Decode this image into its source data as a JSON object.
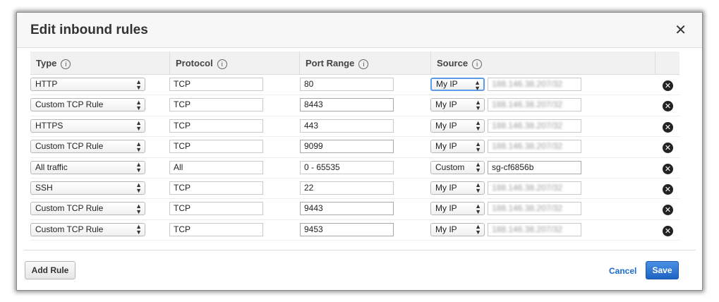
{
  "modal": {
    "title": "Edit inbound rules",
    "close_glyph": "✕"
  },
  "columns": {
    "type": "Type",
    "protocol": "Protocol",
    "port_range": "Port Range",
    "source": "Source",
    "info_glyph": "i"
  },
  "rules": [
    {
      "type": "HTTP",
      "protocol": "TCP",
      "port": "80",
      "source_type": "My IP",
      "source_value": "188.146.38.207/32"
    },
    {
      "type": "Custom TCP Rule",
      "protocol": "TCP",
      "port": "8443",
      "source_type": "My IP",
      "source_value": "188.146.38.207/32"
    },
    {
      "type": "HTTPS",
      "protocol": "TCP",
      "port": "443",
      "source_type": "My IP",
      "source_value": "188.146.38.207/32"
    },
    {
      "type": "Custom TCP Rule",
      "protocol": "TCP",
      "port": "9099",
      "source_type": "My IP",
      "source_value": "188.146.38.207/32"
    },
    {
      "type": "All traffic",
      "protocol": "All",
      "port": "0 - 65535",
      "source_type": "Custom",
      "source_value": "sg-cf6856b5"
    },
    {
      "type": "SSH",
      "protocol": "TCP",
      "port": "22",
      "source_type": "My IP",
      "source_value": "188.146.38.207/32"
    },
    {
      "type": "Custom TCP Rule",
      "protocol": "TCP",
      "port": "9443",
      "source_type": "My IP",
      "source_value": "188.146.38.207/32"
    },
    {
      "type": "Custom TCP Rule",
      "protocol": "TCP",
      "port": "9453",
      "source_type": "My IP",
      "source_value": "188.146.38.207/32"
    }
  ],
  "footer": {
    "add_rule": "Add Rule",
    "cancel": "Cancel",
    "save": "Save"
  },
  "colors": {
    "primary": "#1e63c4",
    "link": "#1a6ad1",
    "focus_border": "#5b9be8"
  }
}
